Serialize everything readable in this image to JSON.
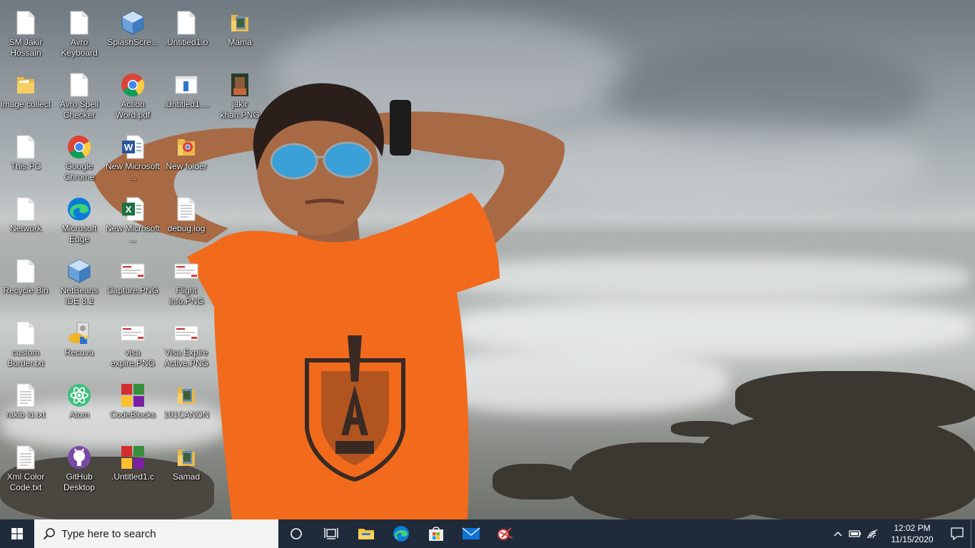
{
  "desktop": {
    "icons": [
      {
        "label": "SM Jakir Hossain",
        "icon": "blank-file-icon"
      },
      {
        "label": "Avro Keyboard",
        "icon": "blank-file-icon"
      },
      {
        "label": "SplashScre...",
        "icon": "netbeans-cube-icon"
      },
      {
        "label": ".Untitled1.o",
        "icon": "blank-file-icon"
      },
      {
        "label": "Mama",
        "icon": "folder-photo-icon"
      },
      {
        "label": "image collect",
        "icon": "folder-icon"
      },
      {
        "label": "Avro Spell Checker",
        "icon": "blank-file-icon"
      },
      {
        "label": "Action Word.pdf",
        "icon": "chrome-icon"
      },
      {
        "label": ".Untitled1....",
        "icon": "window-file-icon"
      },
      {
        "label": "jakir khan.PNG",
        "icon": "photo-thumbnail-icon"
      },
      {
        "label": "This PC",
        "icon": "blank-file-icon"
      },
      {
        "label": "Google Chrome",
        "icon": "chrome-icon"
      },
      {
        "label": "New Microsoft ...",
        "icon": "word-doc-icon"
      },
      {
        "label": "New folder",
        "icon": "folder-chrome-icon"
      },
      {
        "label": "Network",
        "icon": "blank-file-icon"
      },
      {
        "label": "Microsoft Edge",
        "icon": "edge-icon"
      },
      {
        "label": "New Microsoft ...",
        "icon": "excel-sheet-icon"
      },
      {
        "label": "debug.log",
        "icon": "text-file-icon"
      },
      {
        "label": "Recycle Bin",
        "icon": "blank-file-icon"
      },
      {
        "label": "NetBeans IDE 8.2",
        "icon": "netbeans-cube-icon"
      },
      {
        "label": "Capture.PNG",
        "icon": "screenshot-thumbnail-icon"
      },
      {
        "label": "Flight Info.PNG",
        "icon": "screenshot-thumbnail-icon"
      },
      {
        "label": "custom Border.txt",
        "icon": "blank-file-icon"
      },
      {
        "label": "Recuva",
        "icon": "recuva-icon"
      },
      {
        "label": "visa expire.PNG",
        "icon": "screenshot-thumbnail-icon"
      },
      {
        "label": "Visa Expire Active.PNG",
        "icon": "screenshot-thumbnail-icon"
      },
      {
        "label": "rakib id.txt",
        "icon": "text-file-icon"
      },
      {
        "label": "Atom",
        "icon": "atom-icon"
      },
      {
        "label": "CodeBlocks",
        "icon": "codeblocks-icon"
      },
      {
        "label": "101CANON",
        "icon": "folder-photo-icon"
      },
      {
        "label": "Xml Color Code.txt",
        "icon": "text-file-icon"
      },
      {
        "label": "GitHub Desktop",
        "icon": "github-icon"
      },
      {
        "label": ".Untitled1.c",
        "icon": "codeblocks-icon"
      },
      {
        "label": "Samad",
        "icon": "folder-photo-icon"
      }
    ]
  },
  "taskbar": {
    "search_placeholder": "Type here to search",
    "pinned": [
      {
        "name": "cortana-icon"
      },
      {
        "name": "task-view-icon"
      },
      {
        "name": "file-explorer-icon"
      },
      {
        "name": "edge-icon"
      },
      {
        "name": "microsoft-store-icon"
      },
      {
        "name": "mail-icon"
      },
      {
        "name": "snipping-tool-icon"
      }
    ],
    "clock": {
      "time": "12:02 PM",
      "date": "11/15/2020"
    }
  },
  "colors": {
    "taskbar_bg": "#1f2b3a",
    "search_bg": "#f3f3f3",
    "shirt": "#f26b1d"
  }
}
